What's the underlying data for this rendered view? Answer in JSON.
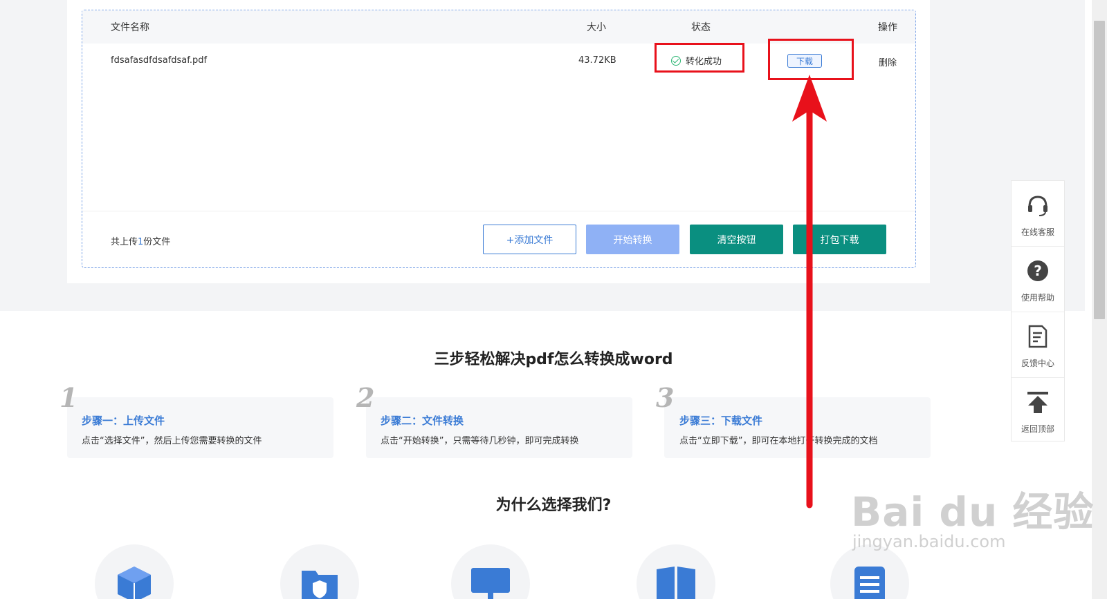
{
  "table": {
    "headers": {
      "name": "文件名称",
      "size": "大小",
      "status": "状态",
      "action": "操作"
    },
    "rows": [
      {
        "name": "fdsafasdfdsafdsaf.pdf",
        "size": "43.72KB",
        "status": "转化成功",
        "download": "下载",
        "delete": "删除"
      }
    ]
  },
  "footer": {
    "count_prefix": "共上传",
    "count_num": "1",
    "count_suffix": "份文件",
    "buttons": {
      "add": "+添加文件",
      "start": "开始转换",
      "clear": "清空按钮",
      "pack": "打包下载"
    }
  },
  "steps_section": {
    "title": "三步轻松解决pdf怎么转换成word",
    "steps": [
      {
        "num": "1",
        "title": "步骤一：上传文件",
        "desc": "点击“选择文件”，然后上传您需要转换的文件"
      },
      {
        "num": "2",
        "title": "步骤二：文件转换",
        "desc": "点击“开始转换”，只需等待几秒钟，即可完成转换"
      },
      {
        "num": "3",
        "title": "步骤三：下载文件",
        "desc": "点击“立即下载”，即可在本地打开转换完成的文档"
      }
    ]
  },
  "why_section": {
    "title": "为什么选择我们?"
  },
  "sidebar": {
    "items": [
      {
        "label": "在线客服",
        "icon": "headset-icon"
      },
      {
        "label": "使用帮助",
        "icon": "help-icon"
      },
      {
        "label": "反馈中心",
        "icon": "feedback-icon"
      },
      {
        "label": "返回顶部",
        "icon": "back-to-top-icon"
      }
    ]
  },
  "watermark": {
    "main": "Bai du 经验",
    "sub": "jingyan.baidu.com"
  },
  "colors": {
    "accent": "#3a7bd5",
    "teal": "#0a8f80",
    "highlight": "#e8111b",
    "success": "#2bb673"
  }
}
